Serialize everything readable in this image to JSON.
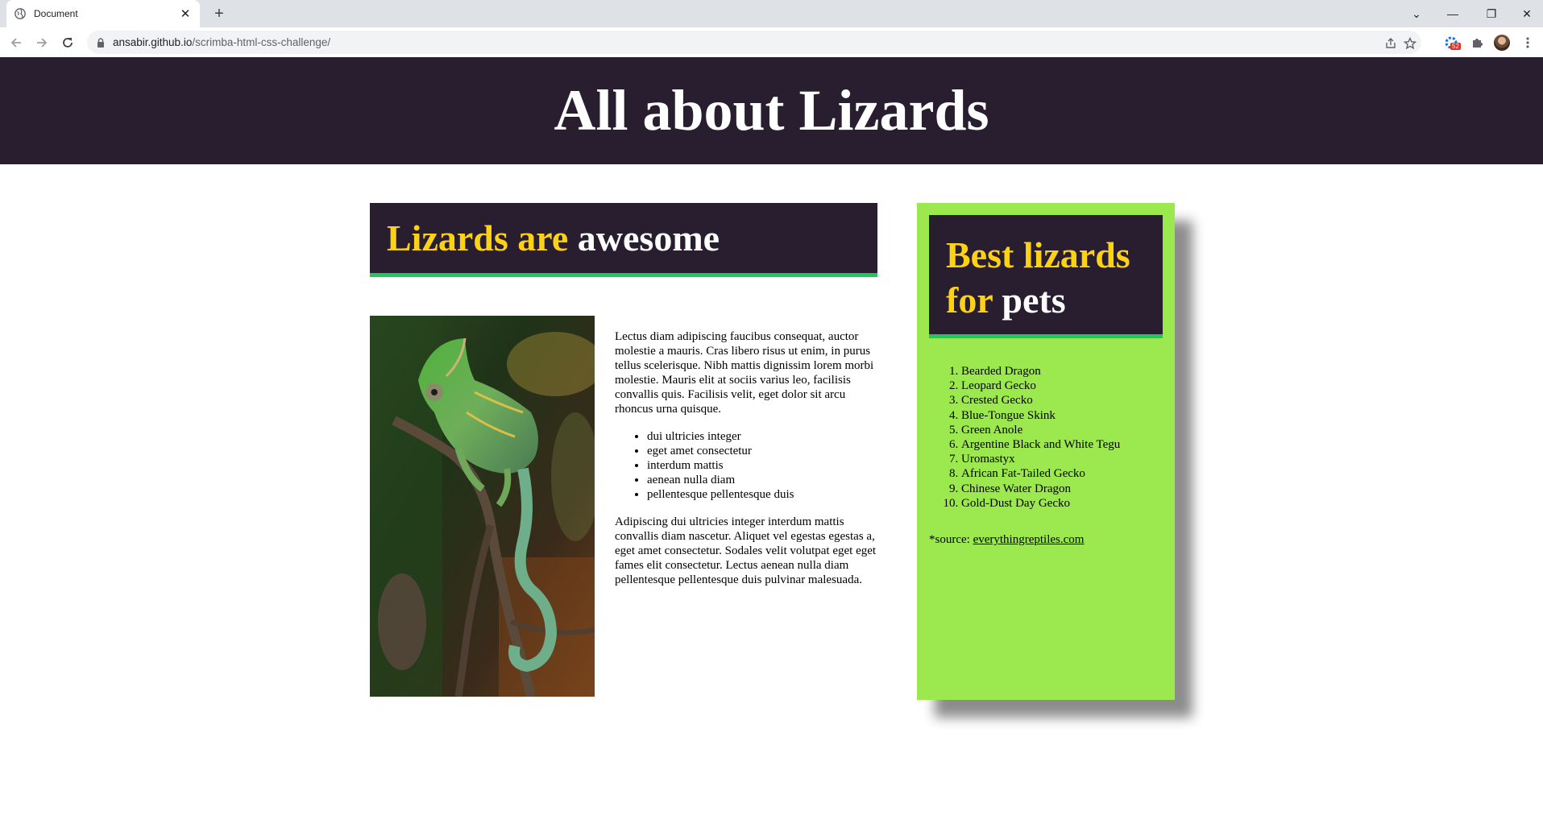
{
  "browser": {
    "tab_title": "Document",
    "tab_close": "✕",
    "new_tab": "+",
    "url_host": "ansabir.github.io",
    "url_path": "/scrimba-html-css-challenge/",
    "extension_badge": "52",
    "window_controls": {
      "tab_search": "⌄",
      "minimize": "—",
      "restore": "❐",
      "close": "✕"
    }
  },
  "header": {
    "title": "All about Lizards"
  },
  "main": {
    "heading_part1": "Lizards are",
    "heading_part2": "awesome",
    "image_alt": "Chameleon on a branch",
    "paragraph1": "Lectus diam adipiscing faucibus consequat, auctor molestie a mauris. Cras libero risus ut enim, in purus tellus scelerisque. Nibh mattis dignissim lorem morbi molestie. Mauris elit at sociis varius leo, facilisis convallis quis. Facilisis velit, eget dolor sit arcu rhoncus urna quisque.",
    "bullets": [
      "dui ultricies integer",
      "eget amet consectetur",
      "interdum mattis",
      "aenean nulla diam",
      "pellentesque pellentesque duis"
    ],
    "paragraph2": "Adipiscing dui ultricies integer interdum mattis convallis diam nascetur. Aliquet vel egestas egestas a, eget amet consectetur. Sodales velit volutpat eget eget fames elit consectetur. Lectus aenean nulla diam pellentesque pellentesque duis pulvinar malesuada."
  },
  "sidebar": {
    "heading_part1": "Best lizards for",
    "heading_part2": "pets",
    "list": [
      "Bearded Dragon",
      "Leopard Gecko",
      "Crested Gecko",
      "Blue-Tongue Skink",
      "Green Anole",
      "Argentine Black and White Tegu",
      "Uromastyx",
      "African Fat-Tailed Gecko",
      "Chinese Water Dragon",
      "Gold-Dust Day Gecko"
    ],
    "source_label": "*source:",
    "source_link": "everythingreptiles.com"
  },
  "colors": {
    "header_bg": "#281e30",
    "accent_yellow": "#fcd116",
    "accent_green": "#22c55e",
    "sidebar_bg": "#9be84f"
  }
}
